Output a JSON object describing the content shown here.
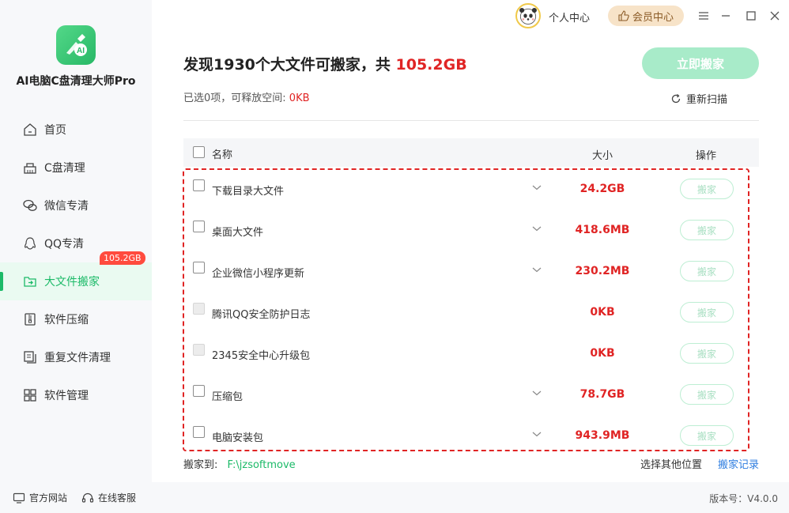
{
  "app": {
    "name": "AI电脑C盘清理大师Pro"
  },
  "top": {
    "user_center": "个人中心",
    "vip_center": "会员中心"
  },
  "sidebar": {
    "items": [
      {
        "label": "首页",
        "icon": "home-icon"
      },
      {
        "label": "C盘清理",
        "icon": "broom-icon"
      },
      {
        "label": "微信专清",
        "icon": "wechat-icon"
      },
      {
        "label": "QQ专清",
        "icon": "qq-icon"
      },
      {
        "label": "大文件搬家",
        "icon": "folder-move-icon",
        "badge": "105.2GB",
        "active": true
      },
      {
        "label": "软件压缩",
        "icon": "zip-icon"
      },
      {
        "label": "重复文件清理",
        "icon": "duplicate-icon"
      },
      {
        "label": "软件管理",
        "icon": "apps-icon"
      }
    ]
  },
  "header": {
    "title_prefix": "发现1930个大文件可搬家，共",
    "title_total": "105.2GB",
    "selected_prefix": "已选0项，可释放空间:",
    "selected_size": "0KB",
    "move_now": "立即搬家",
    "rescan": "重新扫描"
  },
  "table": {
    "col_name": "名称",
    "col_size": "大小",
    "col_action": "操作",
    "action_label": "搬家",
    "rows": [
      {
        "name": "下载目录大文件",
        "size": "24.2GB",
        "expandable": true,
        "disabled": false
      },
      {
        "name": "桌面大文件",
        "size": "418.6MB",
        "expandable": true,
        "disabled": false
      },
      {
        "name": "企业微信小程序更新",
        "size": "230.2MB",
        "expandable": true,
        "disabled": false
      },
      {
        "name": "腾讯QQ安全防护日志",
        "size": "0KB",
        "expandable": false,
        "disabled": true
      },
      {
        "name": "2345安全中心升级包",
        "size": "0KB",
        "expandable": false,
        "disabled": true
      },
      {
        "name": "压缩包",
        "size": "78.7GB",
        "expandable": true,
        "disabled": false
      },
      {
        "name": "电脑安装包",
        "size": "943.9MB",
        "expandable": true,
        "disabled": false
      }
    ]
  },
  "footer": {
    "move_to_label": "搬家到:",
    "move_to_path": "F:\\jzsoftmove",
    "other_location": "选择其他位置",
    "move_log": "搬家记录"
  },
  "bottombar": {
    "website": "官方网站",
    "support": "在线客服",
    "version": "版本号：V4.0.0"
  },
  "colors": {
    "accent": "#1cba68",
    "danger": "#e02424",
    "link": "#2e7de0"
  }
}
